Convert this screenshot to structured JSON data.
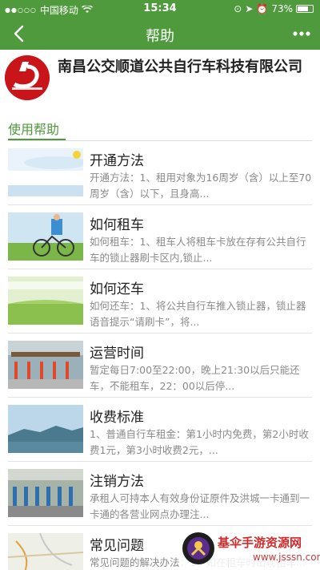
{
  "status_bar": {
    "carrier": "中国移动",
    "time": "15:34",
    "battery_percent": "73%",
    "battery_level": 0.73
  },
  "nav": {
    "title": "帮助"
  },
  "company": {
    "name": "南昌公交顺道公共自行车科技有限公司"
  },
  "section": {
    "title": "使用帮助"
  },
  "items": [
    {
      "title": "开通方法",
      "desc": "开通方法：1、租用对象为16周岁（含）以上至70周岁（含）以下，且身高..."
    },
    {
      "title": "如何租车",
      "desc": "如何租车：1、租车人将租车卡放在存有公共自行车的锁止器刷卡区内,锁止..."
    },
    {
      "title": "如何还车",
      "desc": "如何还车：1、将公共自行车推入锁止器，锁止器语音提示“请刷卡”，将..."
    },
    {
      "title": "运营时间",
      "desc": "暂定每日7:00至22:00，晚上21:30以后只能还车，不能租车，22：00以后停..."
    },
    {
      "title": "收费标准",
      "desc": "1、普通自行车租金：第1小时内免费，第2小时收费1元，第3小时收费2元，..."
    },
    {
      "title": "注销方法",
      "desc": "承租人可持本人有效身份证原件及洪城一卡通到一卡通的各营业网点办理注..."
    },
    {
      "title": "常见问题",
      "desc": "常见问题的解决办法：1、如在租车时出现租车..."
    }
  ],
  "watermark": {
    "text": "基伞手游资源网",
    "url": "www.jsssn.com"
  }
}
